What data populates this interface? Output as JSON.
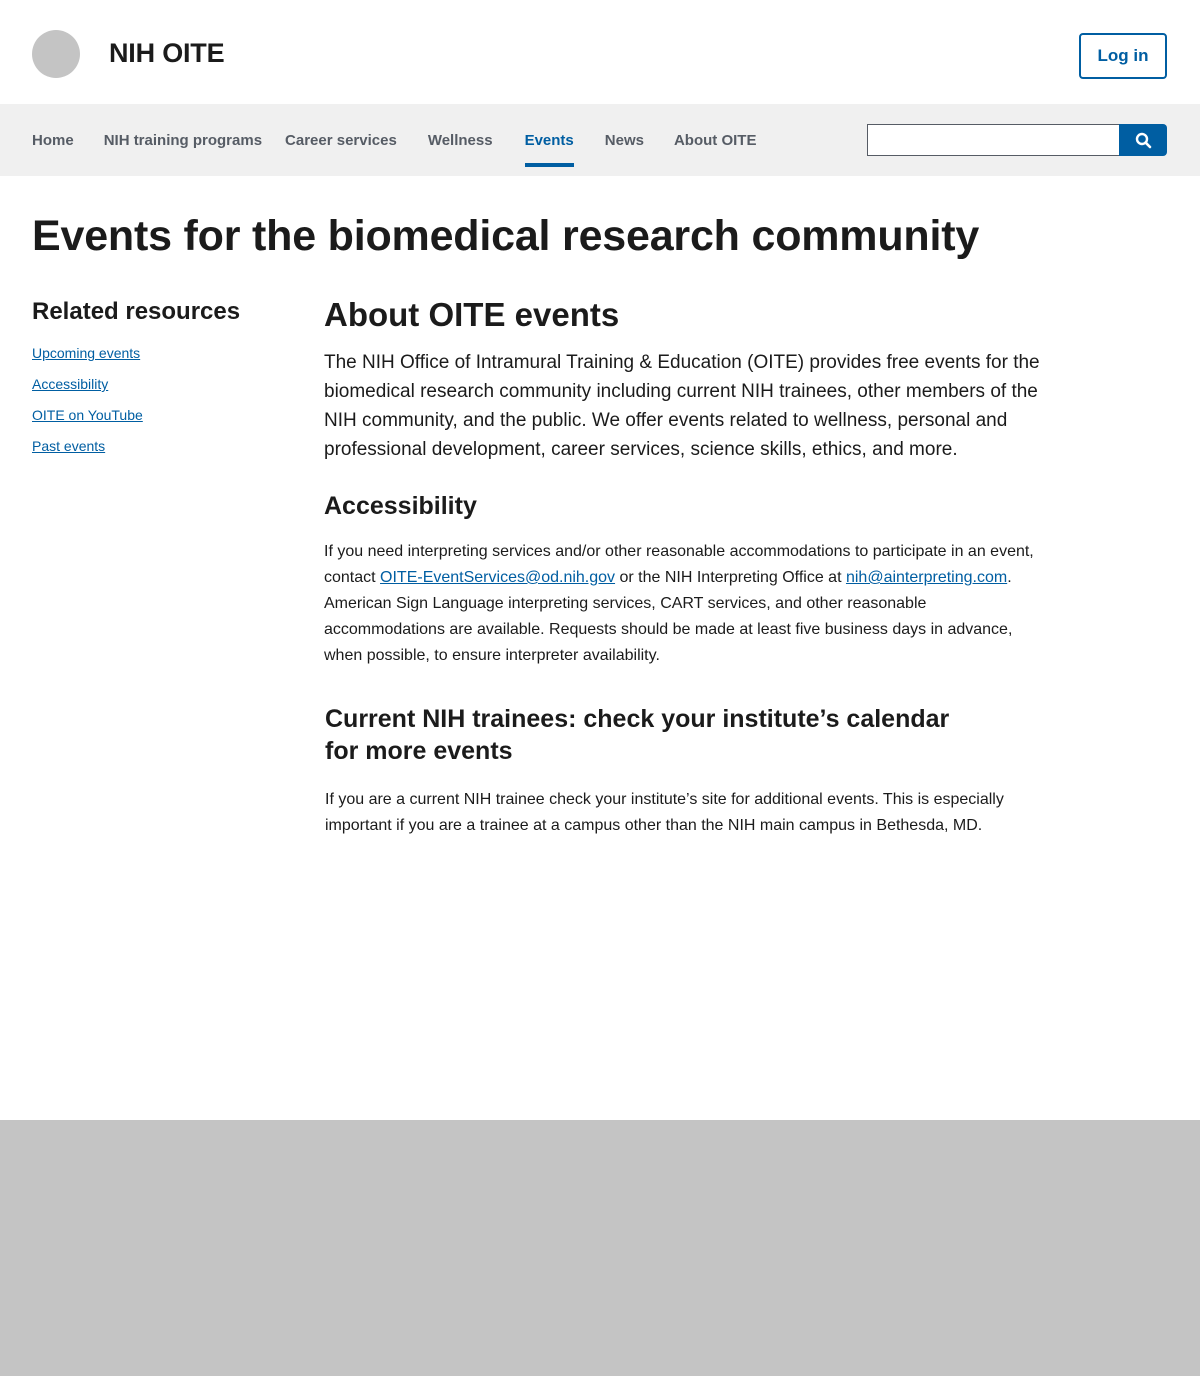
{
  "header": {
    "site_title": "NIH OITE",
    "login_label": "Log in"
  },
  "nav": {
    "items": [
      {
        "label": "Home"
      },
      {
        "label": "NIH training programs"
      },
      {
        "label": "Career services"
      },
      {
        "label": "Wellness"
      },
      {
        "label": "Events",
        "active": true
      },
      {
        "label": "News"
      },
      {
        "label": "About OITE"
      }
    ],
    "search": {
      "value": "",
      "button_icon": "search-icon"
    }
  },
  "page": {
    "title": "Events for the biomedical research community"
  },
  "sidebar": {
    "heading": "Related resources",
    "links": [
      {
        "label": "Upcoming events"
      },
      {
        "label": "Accessibility"
      },
      {
        "label": "OITE on YouTube"
      },
      {
        "label": "Past events"
      }
    ]
  },
  "content": {
    "about_heading": "About OITE events",
    "about_text": "The NIH Office of Intramural Training & Education (OITE) provides free events for the biomedical research community including current NIH trainees, other members of the NIH community, and the public. We offer events related to wellness, personal and professional development, career services, science skills, ethics, and more.",
    "accessibility_heading": "Accessibility",
    "accessibility_text_1": "If you need interpreting services and/or other reasonable accommodations to participate in an event, contact ",
    "accessibility_email_1": "OITE-EventServices@od.nih.gov",
    "accessibility_text_2": " or the NIH Interpreting Office at ",
    "accessibility_email_2": "nih@ainterpreting.com",
    "accessibility_text_3": ". American Sign Language interpreting services, CART services, and other reasonable accommodations are available. Requests should be made at least five business days in advance, when possible, to ensure interpreter availability.",
    "trainees_heading": "Current NIH trainees: check your institute’s calendar for more events",
    "trainees_text": "If you are a current NIH trainee check your institute’s site for additional events. This is especially important if you are a trainee at a campus other than the NIH main campus in Bethesda, MD."
  },
  "colors": {
    "accent": "#005ea2",
    "nav_bg": "#f0f0f0",
    "footer_bg": "#c4c4c4",
    "logo_placeholder": "#c4c4c4"
  }
}
